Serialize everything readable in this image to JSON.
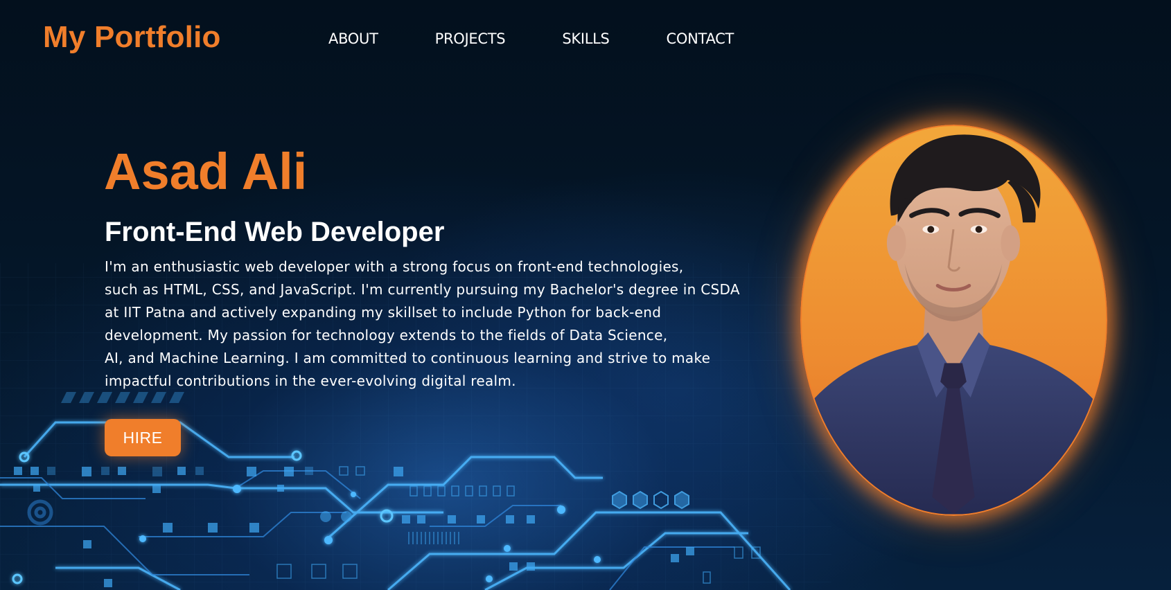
{
  "header": {
    "brand": "My Portfolio",
    "nav": [
      "ABOUT",
      "PROJECTS",
      "SKILLS",
      "CONTACT"
    ]
  },
  "hero": {
    "name": "Asad Ali",
    "role": "Front-End Web Developer",
    "bio_lines": [
      "I'm an enthusiastic web developer with a strong focus on front-end technologies,",
      "such as HTML, CSS, and JavaScript. I'm currently pursuing my Bachelor's degree in CSDA",
      "at IIT Patna and actively expanding my skillset to include Python for back-end",
      "development. My passion for technology extends to the fields of Data Science,",
      "AI, and Machine Learning. I am committed to continuous learning and strive to make",
      "impactful contributions in the ever-evolving digital realm."
    ],
    "cta_label": "HIRE"
  },
  "colors": {
    "accent": "#f07e2b",
    "background": "#030f1c",
    "text": "#ffffff",
    "circuit": "#3fa9f5"
  },
  "images": {
    "portrait": "profile-photo"
  }
}
